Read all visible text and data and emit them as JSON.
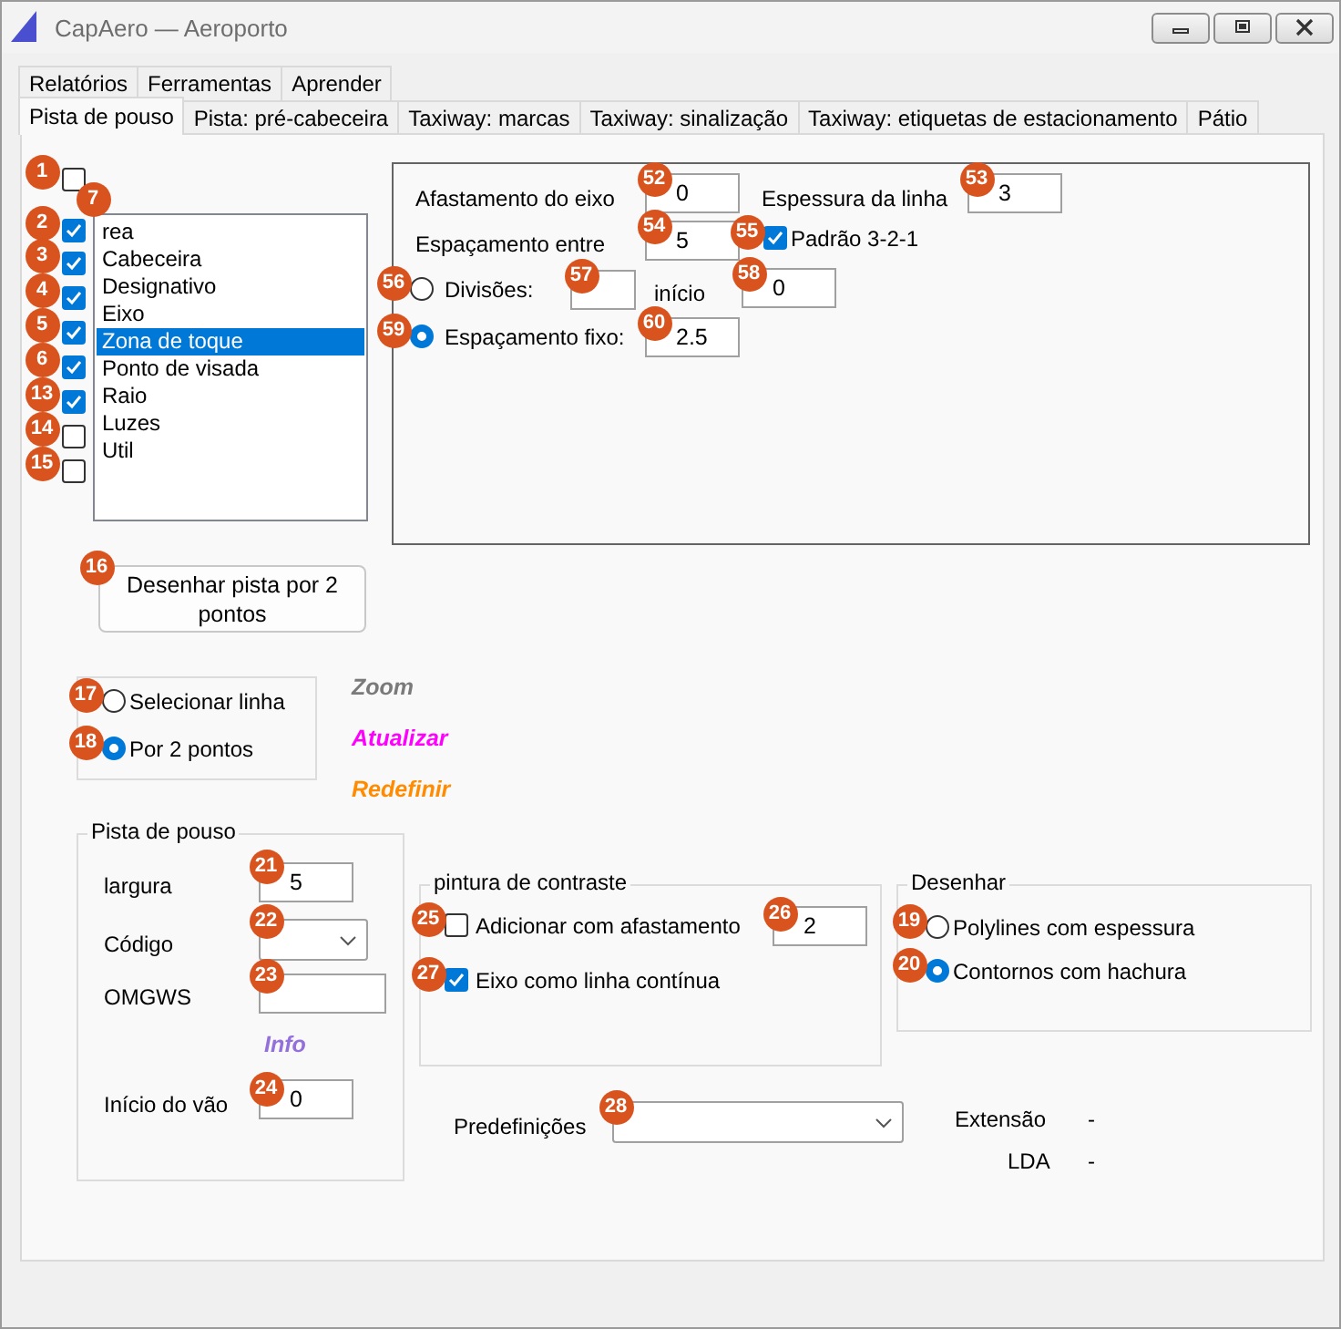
{
  "window": {
    "title": "CapAero — Aeroporto"
  },
  "tabs_top": [
    {
      "label": "Relatórios",
      "selected": false
    },
    {
      "label": "Ferramentas",
      "selected": false
    },
    {
      "label": "Aprender",
      "selected": false
    }
  ],
  "tabs": [
    {
      "label": "Pista de pouso",
      "selected": true
    },
    {
      "label": "Pista: pré-cabeceira",
      "selected": false
    },
    {
      "label": "Taxiway: marcas",
      "selected": false
    },
    {
      "label": "Taxiway: sinalização",
      "selected": false
    },
    {
      "label": "Taxiway: etiquetas de estacionamento",
      "selected": false
    },
    {
      "label": "Pátio",
      "selected": false
    }
  ],
  "groups": [
    {
      "kind": "panel"
    },
    {
      "kind": "frame"
    },
    {
      "kind": "groupbox",
      "title": "Pista de pouso"
    },
    {
      "kind": "groupbox",
      "title": "pintura de contraste"
    },
    {
      "kind": "groupbox",
      "title": "Desenhar"
    }
  ],
  "controls": [
    {
      "kind": "checkbox",
      "badge": "1",
      "checked": false
    },
    {
      "kind": "checkbox",
      "badge": "2",
      "checked": true
    },
    {
      "kind": "checkbox",
      "badge": "3",
      "checked": true
    },
    {
      "kind": "checkbox",
      "badge": "4",
      "checked": true
    },
    {
      "kind": "checkbox",
      "badge": "5",
      "checked": true
    },
    {
      "kind": "checkbox",
      "badge": "6",
      "checked": true
    },
    {
      "kind": "checkbox",
      "badge": "13",
      "checked": true
    },
    {
      "kind": "checkbox",
      "badge": "14",
      "checked": false
    },
    {
      "kind": "checkbox",
      "badge": "15",
      "checked": false
    },
    {
      "kind": "listbox",
      "badge": "7",
      "items": [
        {
          "label": "rea",
          "selected": false
        },
        {
          "label": "Cabeceira",
          "selected": false
        },
        {
          "label": "Designativo",
          "selected": false
        },
        {
          "label": "Eixo",
          "selected": false
        },
        {
          "label": "Zona de toque",
          "selected": true
        },
        {
          "label": "Ponto de visada",
          "selected": false
        },
        {
          "label": "Raio",
          "selected": false
        },
        {
          "label": "Luzes",
          "selected": false
        },
        {
          "label": "Util",
          "selected": false
        }
      ]
    },
    {
      "kind": "label",
      "text": "Afastamento do eixo"
    },
    {
      "kind": "field",
      "badge": "52",
      "value": "0"
    },
    {
      "kind": "label",
      "text": "Espessura da linha"
    },
    {
      "kind": "field",
      "badge": "53",
      "value": "3"
    },
    {
      "kind": "label",
      "text": "Espaçamento entre"
    },
    {
      "kind": "field",
      "badge": "54",
      "value": "5"
    },
    {
      "kind": "checkbox",
      "badge": "55",
      "checked": true,
      "label": "Padrão 3-2-1"
    },
    {
      "kind": "radio",
      "badge": "56",
      "selected": false,
      "label": "Divisões:"
    },
    {
      "kind": "field",
      "badge": "57"
    },
    {
      "kind": "label",
      "text": "início"
    },
    {
      "kind": "field",
      "badge": "58",
      "value": "0"
    },
    {
      "kind": "radio",
      "badge": "59",
      "selected": true,
      "label": "Espaçamento fixo:"
    },
    {
      "kind": "field",
      "badge": "60",
      "value": "2.5"
    },
    {
      "kind": "button",
      "badge": "16",
      "label": "Desenhar pista por 2 pontos"
    },
    {
      "kind": "radio",
      "badge": "17",
      "selected": false,
      "label": "Selecionar linha"
    },
    {
      "kind": "radio",
      "badge": "18",
      "selected": true,
      "label": "Por 2 pontos"
    },
    {
      "kind": "link",
      "text": "Zoom",
      "color": "#7a7a7a"
    },
    {
      "kind": "link",
      "text": "Atualizar",
      "color": "#ff00ff"
    },
    {
      "kind": "link",
      "text": "Redefinir",
      "color": "#ff8c00"
    },
    {
      "kind": "label",
      "text": "largura"
    },
    {
      "kind": "field",
      "badge": "21",
      "value": "5"
    },
    {
      "kind": "label",
      "text": "Código"
    },
    {
      "kind": "combo",
      "badge": "22"
    },
    {
      "kind": "label",
      "text": "OMGWS"
    },
    {
      "kind": "field",
      "badge": "23"
    },
    {
      "kind": "link",
      "text": "Info",
      "color": "#9370db"
    },
    {
      "kind": "label",
      "text": "Início do vão"
    },
    {
      "kind": "field",
      "badge": "24",
      "value": "0"
    },
    {
      "kind": "checkbox",
      "badge": "25",
      "checked": false,
      "label": "Adicionar com afastamento"
    },
    {
      "kind": "field",
      "badge": "26",
      "value": "2"
    },
    {
      "kind": "checkbox",
      "badge": "27",
      "checked": true,
      "label": "Eixo como linha contínua"
    },
    {
      "kind": "radio",
      "badge": "19",
      "selected": false,
      "label": "Polylines com espessura"
    },
    {
      "kind": "radio",
      "badge": "20",
      "selected": true,
      "label": "Contornos com hachura"
    },
    {
      "kind": "label",
      "text": "Predefinições"
    },
    {
      "kind": "combo",
      "badge": "28"
    },
    {
      "kind": "label",
      "text": "Extensão"
    },
    {
      "kind": "label",
      "text": "-"
    },
    {
      "kind": "label",
      "text": "LDA"
    },
    {
      "kind": "label",
      "text": "-"
    }
  ]
}
